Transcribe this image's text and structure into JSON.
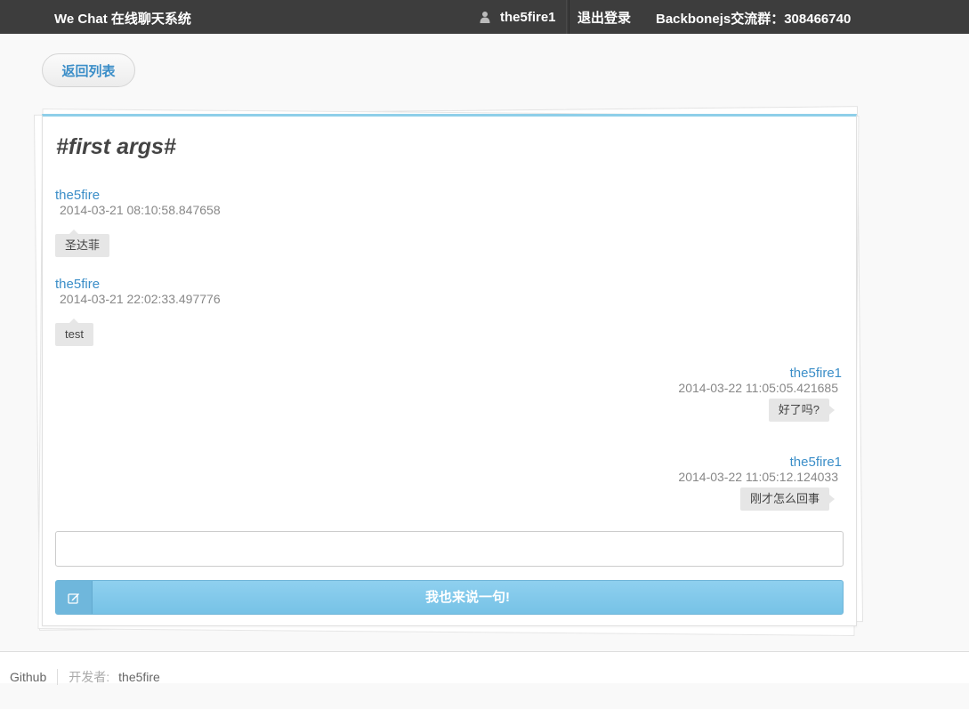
{
  "navbar": {
    "brand": "We Chat 在线聊天系统",
    "username": "the5fire1",
    "user_icon": "user-icon",
    "logout": "退出登录",
    "qq_group": "Backbonejs交流群：308466740"
  },
  "back_button": "返回列表",
  "topic": {
    "title": "#first args#"
  },
  "messages": [
    {
      "author": "the5fire",
      "time": "2014-03-21 08:10:58.847658",
      "content": "圣达菲",
      "side": "left"
    },
    {
      "author": "the5fire",
      "time": "2014-03-21 22:02:33.497776",
      "content": "test",
      "side": "left"
    },
    {
      "author": "the5fire1",
      "time": "2014-03-22 11:05:05.421685",
      "content": "好了吗?",
      "side": "right"
    },
    {
      "author": "the5fire1",
      "time": "2014-03-22 11:05:12.124033",
      "content": "刚才怎么回事",
      "side": "right"
    }
  ],
  "composer": {
    "input_value": "",
    "send_label": "我也来说一句!",
    "send_icon": "edit-icon"
  },
  "footer": {
    "github": "Github",
    "developer_label": "开发者:",
    "developer_name": "the5fire"
  },
  "colors": {
    "navbar_bg": "#3d3d3d",
    "link_blue": "#3b8ec8",
    "accent_blue": "#8ecfe9",
    "bubble_bg": "#e6e6e6"
  }
}
